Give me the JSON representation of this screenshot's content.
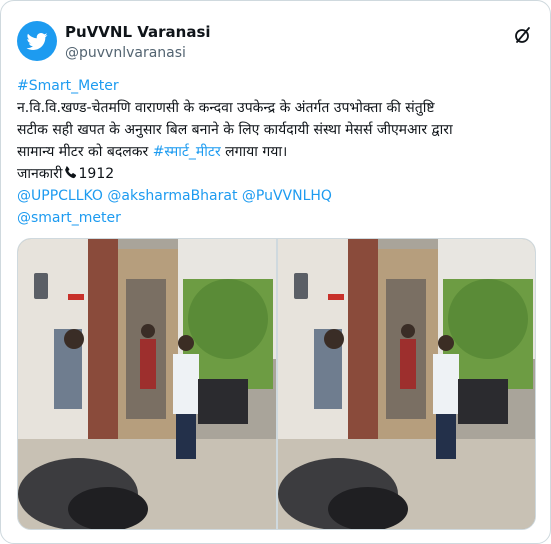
{
  "tweet": {
    "account": {
      "display_name": "PuVVNL Varanasi",
      "handle": "@puvvnlvaranasi",
      "avatar_icon": "twitter-bird-icon",
      "brand_color": "#1d9bf0"
    },
    "header_icon": "x-logo-icon",
    "hashtag": "#Smart_Meter",
    "body_lines": [
      "न.वि.वि.खण्ड-चेतमणि वाराणसी के कन्दवा उपकेन्द्र के अंतर्गत उपभोक्ता की संतुष्टि",
      "सटीक सही खपत के अनुसार बिल बनाने के लिए कार्यदायी संस्था मेसर्स जीएमआर द्वारा"
    ],
    "line3_prefix": "सामान्य मीटर को बदलकर ",
    "line3_hashtag": "#स्मार्ट_मीटर",
    "line3_suffix": " लगाया गया।",
    "info_label": "जानकारी",
    "info_icon": "telephone-icon",
    "info_number": "1912",
    "mentions": [
      "@UPPCLLKO",
      "@aksharmaBharat",
      "@PuVVNLHQ"
    ],
    "mention_last": "@smart_meter",
    "link_color": "#1d9bf0",
    "photos": [
      {
        "icon": "photo-meter-installation"
      },
      {
        "icon": "photo-meter-installation"
      }
    ]
  }
}
